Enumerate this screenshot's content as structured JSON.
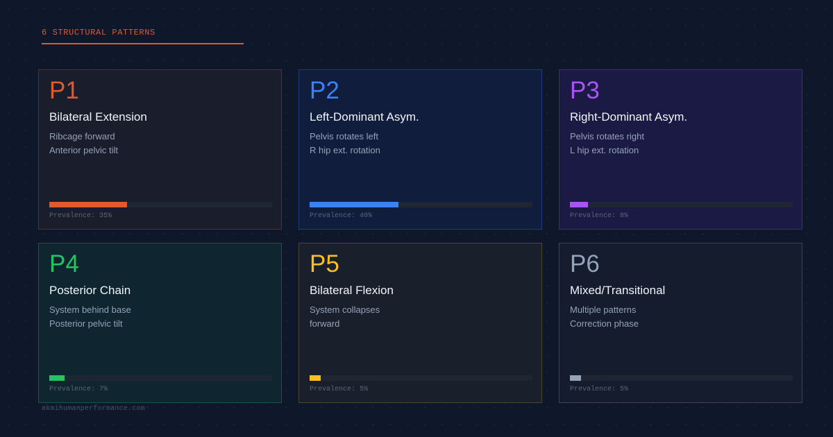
{
  "section": {
    "title": "6 STRUCTURAL PATTERNS",
    "accent": "#e05a2b"
  },
  "cards": [
    {
      "code": "P1",
      "name": "Bilateral Extension",
      "line1": "Ribcage forward",
      "line2": "Anterior pelvic tilt",
      "prevalence_label": "Prevalence:",
      "prevalence_text": "35%",
      "prevalence": 35,
      "color": "#e05a2b",
      "border": "#5c2e24",
      "background": "#1a1d2b"
    },
    {
      "code": "P2",
      "name": "Left-Dominant Asym.",
      "line1": "Pelvis rotates left",
      "line2": "R hip ext. rotation",
      "prevalence_label": "Prevalence:",
      "prevalence_text": "40%",
      "prevalence": 40,
      "color": "#3b82f6",
      "border": "#22397a",
      "background": "#111d3d"
    },
    {
      "code": "P3",
      "name": "Right-Dominant Asym.",
      "line1": "Pelvis rotates right",
      "line2": "L hip ext. rotation",
      "prevalence_label": "Prevalence:",
      "prevalence_text": "8%",
      "prevalence": 8,
      "color": "#a855f7",
      "border": "#3b2d79",
      "background": "#1b1a45"
    },
    {
      "code": "P4",
      "name": "Posterior Chain",
      "line1": "System behind base",
      "line2": "Posterior pelvic tilt",
      "prevalence_label": "Prevalence:",
      "prevalence_text": "7%",
      "prevalence": 7,
      "color": "#22c55e",
      "border": "#17553f",
      "background": "#0f2630"
    },
    {
      "code": "P5",
      "name": "Bilateral Flexion",
      "line1": "System collapses",
      "line2": "forward",
      "prevalence_label": "Prevalence:",
      "prevalence_text": "5%",
      "prevalence": 5,
      "color": "#fbbf24",
      "border": "#4e4634",
      "background": "#1a1f2c"
    },
    {
      "code": "P6",
      "name": "Mixed/Transitional",
      "line1": "Multiple patterns",
      "line2": "Correction phase",
      "prevalence_label": "Prevalence:",
      "prevalence_text": "5%",
      "prevalence": 5,
      "color": "#94a3b8",
      "border": "#3b4453",
      "background": "#141c2d"
    }
  ],
  "footer": {
    "text": "akmihumanperformance.com"
  }
}
